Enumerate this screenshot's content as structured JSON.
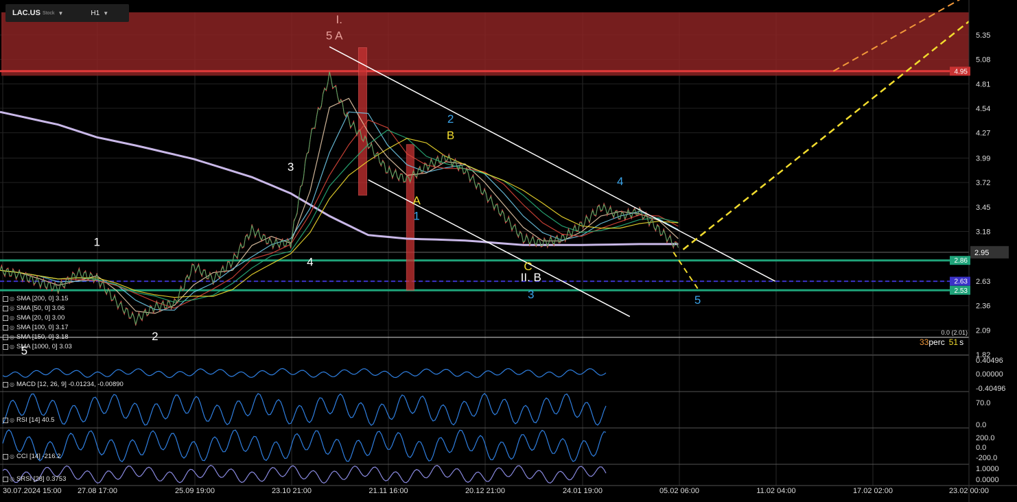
{
  "toolbar": {
    "symbol": "LAC.US",
    "symbol_sub": "Stock",
    "timeframe": "H1"
  },
  "legend": [
    {
      "label": "SMA [200, 0] 3.15"
    },
    {
      "label": "SMA [50, 0] 3.06"
    },
    {
      "label": "SMA [20, 0] 3.00"
    },
    {
      "label": "SMA [100, 0] 3.17"
    },
    {
      "label": "SMA [150, 0] 3.18"
    },
    {
      "label": "SMA [1000, 0] 3.03"
    }
  ],
  "indicators": {
    "macd_label": "MACD [12, 26, 9] -0.01234, -0.00890",
    "rsi_label": "RSI [14] 40.5",
    "cci_label": "CCI [14] -216.2",
    "srsi_label": "SRSI [28] 0.3753"
  },
  "colors": {
    "background": "#000000",
    "resistance_zone": "#8b2323",
    "support_line": "#1fa37a",
    "sma_1000": "#c9b8e8",
    "dashed_level": "#3b32c8",
    "projection": "#f2dc2e",
    "projection_alt": "#f2993a",
    "osc_line": "#2f7fe0"
  },
  "chart_data": {
    "type": "line",
    "title": "",
    "x_ticks": [
      "30.07.2024 15:00",
      "27.08 17:00",
      "25.09 19:00",
      "23.10 21:00",
      "21.11 16:00",
      "20.12 21:00",
      "24.01 19:00",
      "05.02 06:00",
      "11.02 04:00",
      "17.02 02:00",
      "23.02 00:00"
    ],
    "y_ticks": [
      5.35,
      5.08,
      4.81,
      4.54,
      4.27,
      3.99,
      3.72,
      3.45,
      3.18,
      2.95,
      2.63,
      2.36,
      2.09,
      1.82
    ],
    "y_tick_labels": [
      "5.35",
      "5.08",
      "4.81",
      "4.54",
      "4.27",
      "3.99",
      "3.72",
      "3.45",
      "3.18",
      "2.95",
      "2.63",
      "2.36",
      "2.09",
      "1.82"
    ],
    "ylim": [
      1.82,
      5.6
    ],
    "current_price_label": "2.95",
    "price_labels": [
      {
        "value": 4.95,
        "label": "4.95",
        "color": "#c83232"
      },
      {
        "value": 2.86,
        "label": "2.86",
        "color": "#1fa37a"
      },
      {
        "value": 2.63,
        "label": "2.63",
        "color": "#3b32c8"
      },
      {
        "value": 2.53,
        "label": "2.53",
        "color": "#1fa37a"
      }
    ],
    "price_path": [
      [
        0,
        2.75
      ],
      [
        0.02,
        2.7
      ],
      [
        0.04,
        2.62
      ],
      [
        0.06,
        2.55
      ],
      [
        0.08,
        2.72
      ],
      [
        0.1,
        2.66
      ],
      [
        0.12,
        2.4
      ],
      [
        0.14,
        2.2
      ],
      [
        0.16,
        2.35
      ],
      [
        0.18,
        2.38
      ],
      [
        0.2,
        2.8
      ],
      [
        0.22,
        2.65
      ],
      [
        0.24,
        2.85
      ],
      [
        0.26,
        3.2
      ],
      [
        0.28,
        3.05
      ],
      [
        0.3,
        3.05
      ],
      [
        0.32,
        4.2
      ],
      [
        0.34,
        4.9
      ],
      [
        0.36,
        4.4
      ],
      [
        0.38,
        4.15
      ],
      [
        0.4,
        3.85
      ],
      [
        0.42,
        3.75
      ],
      [
        0.44,
        3.9
      ],
      [
        0.46,
        4.0
      ],
      [
        0.48,
        3.85
      ],
      [
        0.5,
        3.6
      ],
      [
        0.52,
        3.35
      ],
      [
        0.54,
        3.1
      ],
      [
        0.56,
        3.05
      ],
      [
        0.58,
        3.1
      ],
      [
        0.6,
        3.25
      ],
      [
        0.62,
        3.45
      ],
      [
        0.64,
        3.35
      ],
      [
        0.66,
        3.4
      ],
      [
        0.68,
        3.2
      ],
      [
        0.7,
        3.0
      ]
    ],
    "sma_1000_path": [
      [
        0,
        4.5
      ],
      [
        0.06,
        4.36
      ],
      [
        0.1,
        4.22
      ],
      [
        0.14,
        4.13
      ],
      [
        0.2,
        3.98
      ],
      [
        0.26,
        3.78
      ],
      [
        0.3,
        3.6
      ],
      [
        0.34,
        3.35
      ],
      [
        0.38,
        3.14
      ],
      [
        0.42,
        3.1
      ],
      [
        0.48,
        3.08
      ],
      [
        0.54,
        3.03
      ],
      [
        0.6,
        3.03
      ],
      [
        0.66,
        3.04
      ],
      [
        0.7,
        3.04
      ]
    ],
    "channel_upper": [
      [
        0.34,
        5.22
      ],
      [
        0.8,
        2.63
      ]
    ],
    "channel_lower": [
      [
        0.38,
        3.75
      ],
      [
        0.65,
        2.24
      ]
    ],
    "projection": [
      [
        0.705,
        2.98
      ],
      [
        1.0,
        5.5
      ]
    ],
    "projection_alt": [
      [
        0.86,
        4.95
      ],
      [
        1.0,
        5.8
      ]
    ],
    "projection_down": [
      [
        0.695,
        2.95
      ],
      [
        0.72,
        2.55
      ]
    ],
    "wave_labels": [
      {
        "text": "I.",
        "x": 0.35,
        "y": 5.48,
        "color": "#e7a09a"
      },
      {
        "text": "5 A",
        "x": 0.345,
        "y": 5.3,
        "color": "#e7a09a"
      },
      {
        "text": "1",
        "x": 0.1,
        "y": 3.02,
        "color": "#ffffff"
      },
      {
        "text": "2",
        "x": 0.16,
        "y": 1.98,
        "color": "#ffffff"
      },
      {
        "text": "3",
        "x": 0.3,
        "y": 3.85,
        "color": "#ffffff"
      },
      {
        "text": "4",
        "x": 0.32,
        "y": 2.8,
        "color": "#ffffff"
      },
      {
        "text": "5",
        "x": 0.025,
        "y": 1.82,
        "color": "#ffffff"
      },
      {
        "text": "A",
        "x": 0.43,
        "y": 3.48,
        "color": "#f2dc2e"
      },
      {
        "text": "1",
        "x": 0.43,
        "y": 3.31,
        "color": "#3aa3e8"
      },
      {
        "text": "2",
        "x": 0.465,
        "y": 4.38,
        "color": "#3aa3e8"
      },
      {
        "text": "B",
        "x": 0.465,
        "y": 4.2,
        "color": "#f2dc2e"
      },
      {
        "text": "C",
        "x": 0.545,
        "y": 2.75,
        "color": "#f2dc2e"
      },
      {
        "text": "II. B",
        "x": 0.548,
        "y": 2.63,
        "color": "#ffffff"
      },
      {
        "text": "3",
        "x": 0.548,
        "y": 2.44,
        "color": "#3aa3e8"
      },
      {
        "text": "4",
        "x": 0.64,
        "y": 3.69,
        "color": "#3aa3e8"
      },
      {
        "text": "5",
        "x": 0.72,
        "y": 2.38,
        "color": "#3aa3e8"
      }
    ],
    "fib_label": "0.0 (2.01)",
    "perc_left": "33",
    "perc_word": "perc",
    "perc_right": "51",
    "perc_right_unit": "s"
  },
  "indicator_axes": {
    "macd": [
      "0.40496",
      "0.00000",
      "-0.40496"
    ],
    "rsi": [
      "70.0",
      "0.0"
    ],
    "cci": [
      "200.0",
      "0.0",
      "-200.0"
    ],
    "srsi": [
      "1.0000",
      "0.0000"
    ]
  }
}
